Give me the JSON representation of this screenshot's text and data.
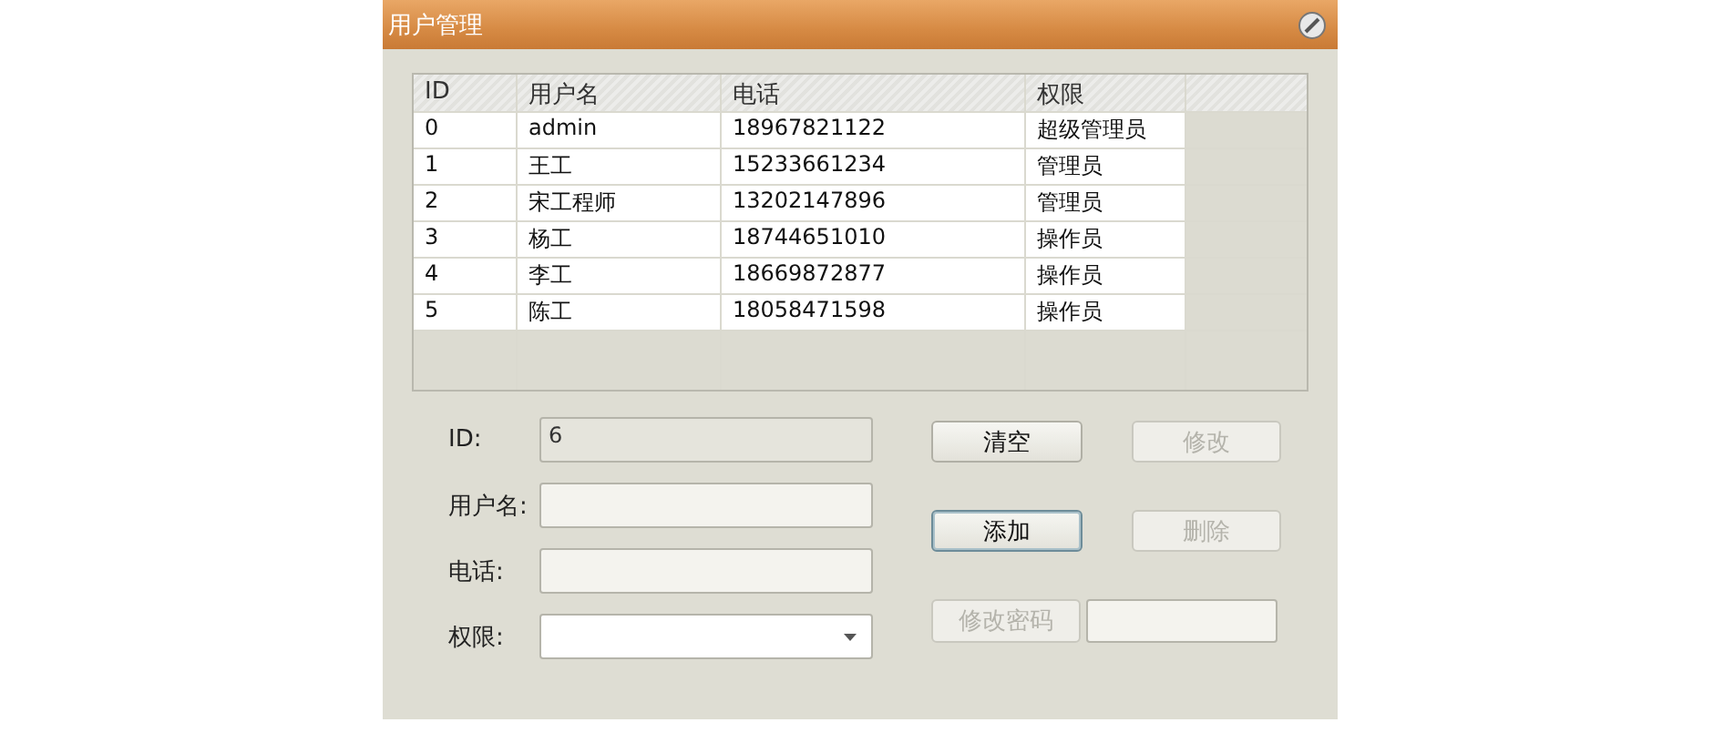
{
  "window": {
    "title": "用户管理"
  },
  "table": {
    "columns": [
      "ID",
      "用户名",
      "电话",
      "权限"
    ],
    "rows": [
      {
        "cells": [
          "0",
          "admin",
          "18967821122",
          "超级管理员"
        ]
      },
      {
        "cells": [
          "1",
          "王工",
          "15233661234",
          "管理员"
        ]
      },
      {
        "cells": [
          "2",
          "宋工程师",
          "13202147896",
          "管理员"
        ]
      },
      {
        "cells": [
          "3",
          "杨工",
          "18744651010",
          "操作员"
        ]
      },
      {
        "cells": [
          "4",
          "李工",
          "18669872877",
          "操作员"
        ]
      },
      {
        "cells": [
          "5",
          "陈工",
          "18058471598",
          "操作员"
        ]
      }
    ]
  },
  "form": {
    "fields": [
      {
        "label": "ID:",
        "kind": "text",
        "value": "6",
        "disabled": true
      },
      {
        "label": "用户名:",
        "kind": "text",
        "disabled": false
      },
      {
        "label": "电话:",
        "kind": "text",
        "disabled": false
      },
      {
        "label": "权限:",
        "kind": "combo",
        "disabled": false
      }
    ]
  },
  "buttons": [
    {
      "label": "清空",
      "disabled": false,
      "focused": false
    },
    {
      "label": "修改",
      "disabled": true,
      "focused": false
    },
    {
      "label": "添加",
      "disabled": false,
      "focused": true
    },
    {
      "label": "删除",
      "disabled": true,
      "focused": false
    },
    {
      "label": "修改密码",
      "disabled": true,
      "focused": false
    }
  ],
  "password_field": {
    "disabled": false
  }
}
